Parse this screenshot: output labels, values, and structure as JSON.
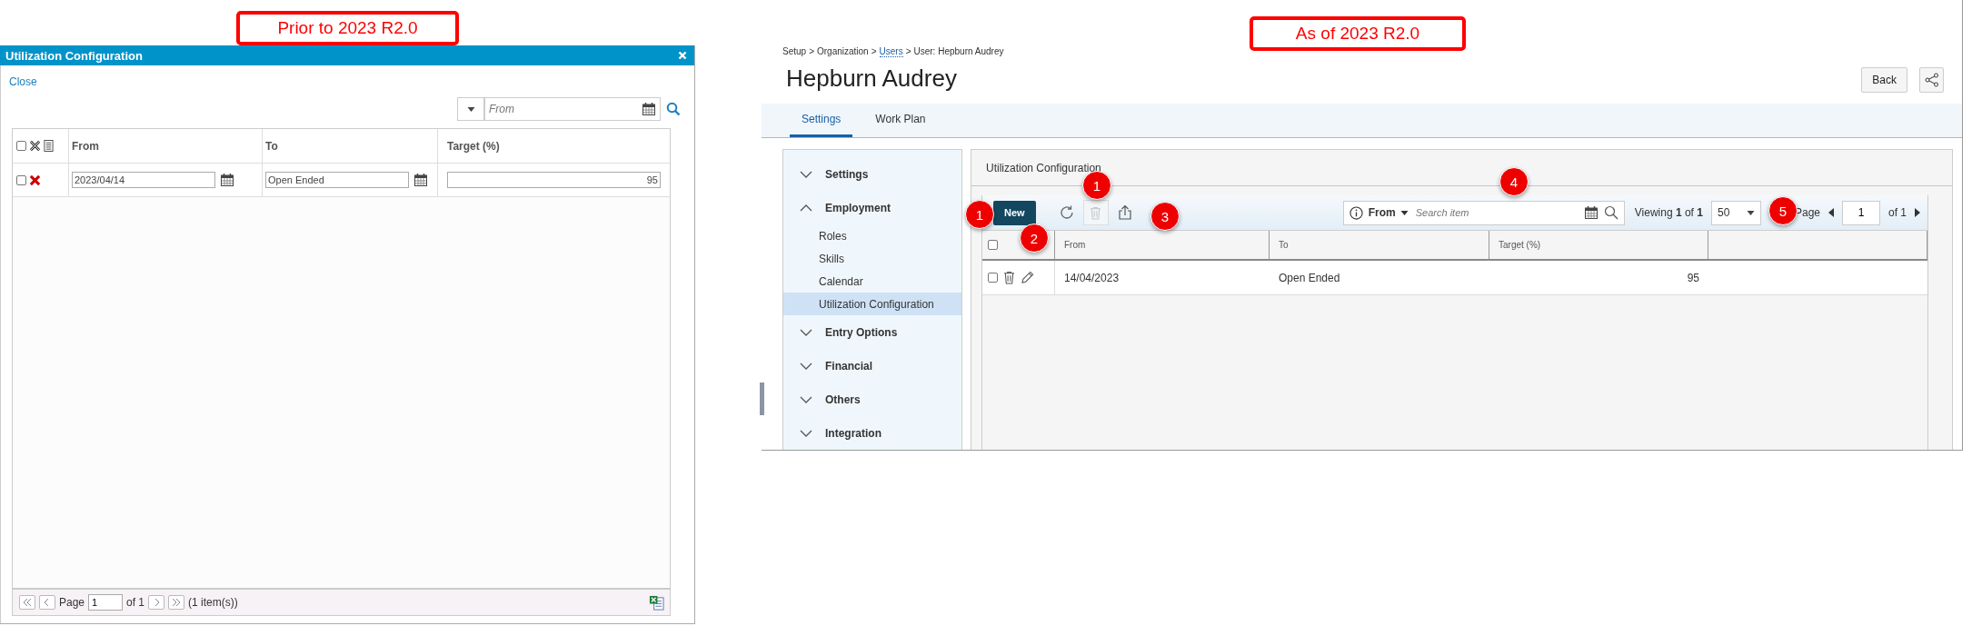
{
  "annotations": [
    {
      "text": "Prior to 2023 R2.0"
    },
    {
      "text": "As of 2023 R2.0"
    }
  ],
  "before": {
    "dialog_title": "Utilization Configuration",
    "close_link": "Close",
    "filter": {
      "placeholder": "From"
    },
    "header_checked": false,
    "columns": [
      "From",
      "To",
      "Target (%)"
    ],
    "rows": [
      {
        "checked": false,
        "from": "2023/04/14",
        "to": "Open Ended",
        "target": "95"
      }
    ],
    "pager": {
      "page_label": "Page",
      "page": "1",
      "of": "of 1",
      "count": "(1 item(s))"
    }
  },
  "after": {
    "breadcrumb": [
      {
        "text": "Setup",
        "link": false
      },
      {
        "text": "Organization",
        "link": false
      },
      {
        "text": "Users",
        "link": true
      },
      {
        "text": "User: Hepburn Audrey",
        "link": false
      }
    ],
    "separator": ">",
    "title": "Hepburn Audrey",
    "back_button": "Back",
    "tabs": [
      {
        "label": "Settings",
        "selected": true
      },
      {
        "label": "Work Plan",
        "selected": false
      }
    ],
    "sidebar": [
      {
        "label": "Settings",
        "expanded": false
      },
      {
        "label": "Employment",
        "expanded": true,
        "children": [
          {
            "label": "Roles",
            "selected": false
          },
          {
            "label": "Skills",
            "selected": false
          },
          {
            "label": "Calendar",
            "selected": false
          },
          {
            "label": "Utilization Configuration",
            "selected": true
          }
        ]
      },
      {
        "label": "Entry Options",
        "expanded": false
      },
      {
        "label": "Financial",
        "expanded": false
      },
      {
        "label": "Others",
        "expanded": false
      },
      {
        "label": "Integration",
        "expanded": false
      }
    ],
    "panel_title": "Utilization Configuration",
    "toolbar": {
      "new_button": "New",
      "delete_disabled": true,
      "filter_field": "From",
      "search": {
        "placeholder": "Search item"
      },
      "viewing": "Viewing **1** of **1**",
      "page_size": "50",
      "page_label": "Page",
      "page": "1",
      "of": "of 1"
    },
    "header_checked": false,
    "columns": [
      "From",
      "To",
      "Target (%)"
    ],
    "rows": [
      {
        "checked": false,
        "from": "14/04/2023",
        "to": "Open Ended",
        "target": "95"
      }
    ],
    "callouts": [
      {
        "number": "1"
      },
      {
        "number": "1"
      },
      {
        "number": "2"
      },
      {
        "number": "3"
      },
      {
        "number": "4"
      },
      {
        "number": "5"
      }
    ]
  }
}
